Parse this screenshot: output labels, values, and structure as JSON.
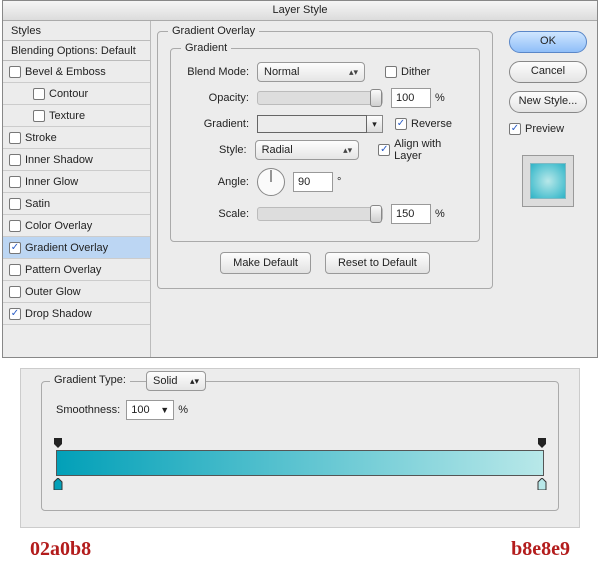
{
  "dialog": {
    "title": "Layer Style"
  },
  "styles": {
    "header": "Styles",
    "blending": "Blending Options: Default",
    "items": [
      {
        "label": "Bevel & Emboss",
        "checked": false,
        "selected": false,
        "indent": false
      },
      {
        "label": "Contour",
        "checked": false,
        "selected": false,
        "indent": true
      },
      {
        "label": "Texture",
        "checked": false,
        "selected": false,
        "indent": true
      },
      {
        "label": "Stroke",
        "checked": false,
        "selected": false,
        "indent": false
      },
      {
        "label": "Inner Shadow",
        "checked": false,
        "selected": false,
        "indent": false
      },
      {
        "label": "Inner Glow",
        "checked": false,
        "selected": false,
        "indent": false
      },
      {
        "label": "Satin",
        "checked": false,
        "selected": false,
        "indent": false
      },
      {
        "label": "Color Overlay",
        "checked": false,
        "selected": false,
        "indent": false
      },
      {
        "label": "Gradient Overlay",
        "checked": true,
        "selected": true,
        "indent": false
      },
      {
        "label": "Pattern Overlay",
        "checked": false,
        "selected": false,
        "indent": false
      },
      {
        "label": "Outer Glow",
        "checked": false,
        "selected": false,
        "indent": false
      },
      {
        "label": "Drop Shadow",
        "checked": true,
        "selected": false,
        "indent": false
      }
    ]
  },
  "overlay": {
    "group_label": "Gradient Overlay",
    "inner_label": "Gradient",
    "blend_mode_label": "Blend Mode:",
    "blend_mode_value": "Normal",
    "dither_label": "Dither",
    "dither_checked": false,
    "opacity_label": "Opacity:",
    "opacity_value": "100",
    "opacity_unit": "%",
    "gradient_label": "Gradient:",
    "reverse_label": "Reverse",
    "reverse_checked": true,
    "style_label": "Style:",
    "style_value": "Radial",
    "align_label": "Align with Layer",
    "align_checked": true,
    "angle_label": "Angle:",
    "angle_value": "90",
    "angle_unit": "°",
    "scale_label": "Scale:",
    "scale_value": "150",
    "scale_unit": "%",
    "make_default": "Make Default",
    "reset_default": "Reset to Default",
    "gradient_colors": {
      "start": "#02a0b8",
      "end": "#b8e8e9"
    }
  },
  "right": {
    "ok": "OK",
    "cancel": "Cancel",
    "new_style": "New Style...",
    "preview_label": "Preview",
    "preview_checked": true
  },
  "geditor": {
    "type_label": "Gradient Type:",
    "type_value": "Solid",
    "smooth_label": "Smoothness:",
    "smooth_value": "100",
    "smooth_unit": "%",
    "stops": {
      "left_hex": "02a0b8",
      "right_hex": "b8e8e9"
    }
  }
}
